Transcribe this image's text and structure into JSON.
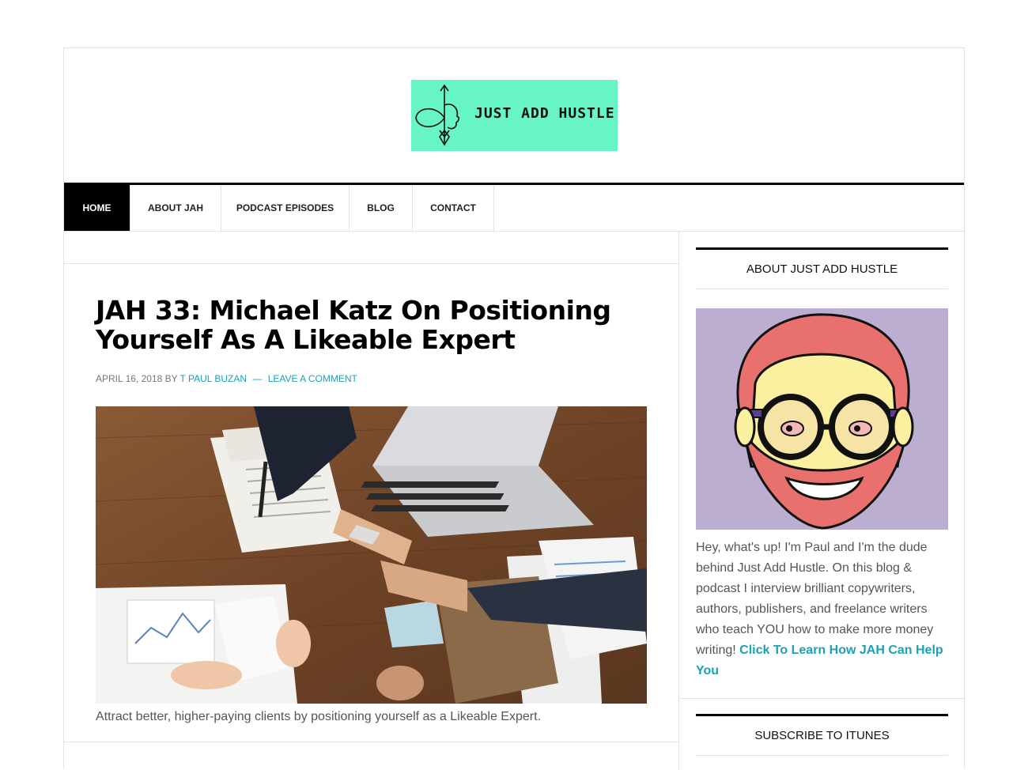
{
  "logo": {
    "text": "JUST ADD HUSTLE",
    "icon": "arrow-face-logo-icon",
    "bg": "#67f5c6"
  },
  "nav": {
    "items": [
      {
        "label": "HOME",
        "active": true
      },
      {
        "label": "ABOUT JAH",
        "active": false
      },
      {
        "label": "PODCAST EPISODES",
        "active": false
      },
      {
        "label": "BLOG",
        "active": false
      },
      {
        "label": "CONTACT",
        "active": false
      }
    ]
  },
  "post": {
    "title": "JAH 33: Michael Katz On Positioning Yourself As A Likeable Expert",
    "date": "APRIL 16, 2018",
    "by": "BY",
    "author": "T PAUL BUZAN",
    "separator": "—",
    "comment_link": "LEAVE A COMMENT",
    "image": "handshake-photo",
    "caption": "Attract better, higher-paying clients by positioning yourself as a Likeable Expert."
  },
  "sidebar": {
    "about_title": "ABOUT JUST ADD HUSTLE",
    "avatar": "cartoon-avatar-illustration",
    "about_text": "Hey, what's up! I'm Paul and I'm the dude behind Just Add Hustle. On this blog & podcast I interview brilliant copywriters, authors, publishers, and freelance writers who teach YOU how to make more money writing!",
    "about_link": "Click To Learn How JAH Can Help You",
    "subscribe_title": "SUBSCRIBE TO ITUNES"
  },
  "colors": {
    "accent": "#1ea0b5",
    "nav_active": "#000000",
    "logo_bg": "#67f5c6",
    "avatar_bg": "#bcaed0"
  }
}
